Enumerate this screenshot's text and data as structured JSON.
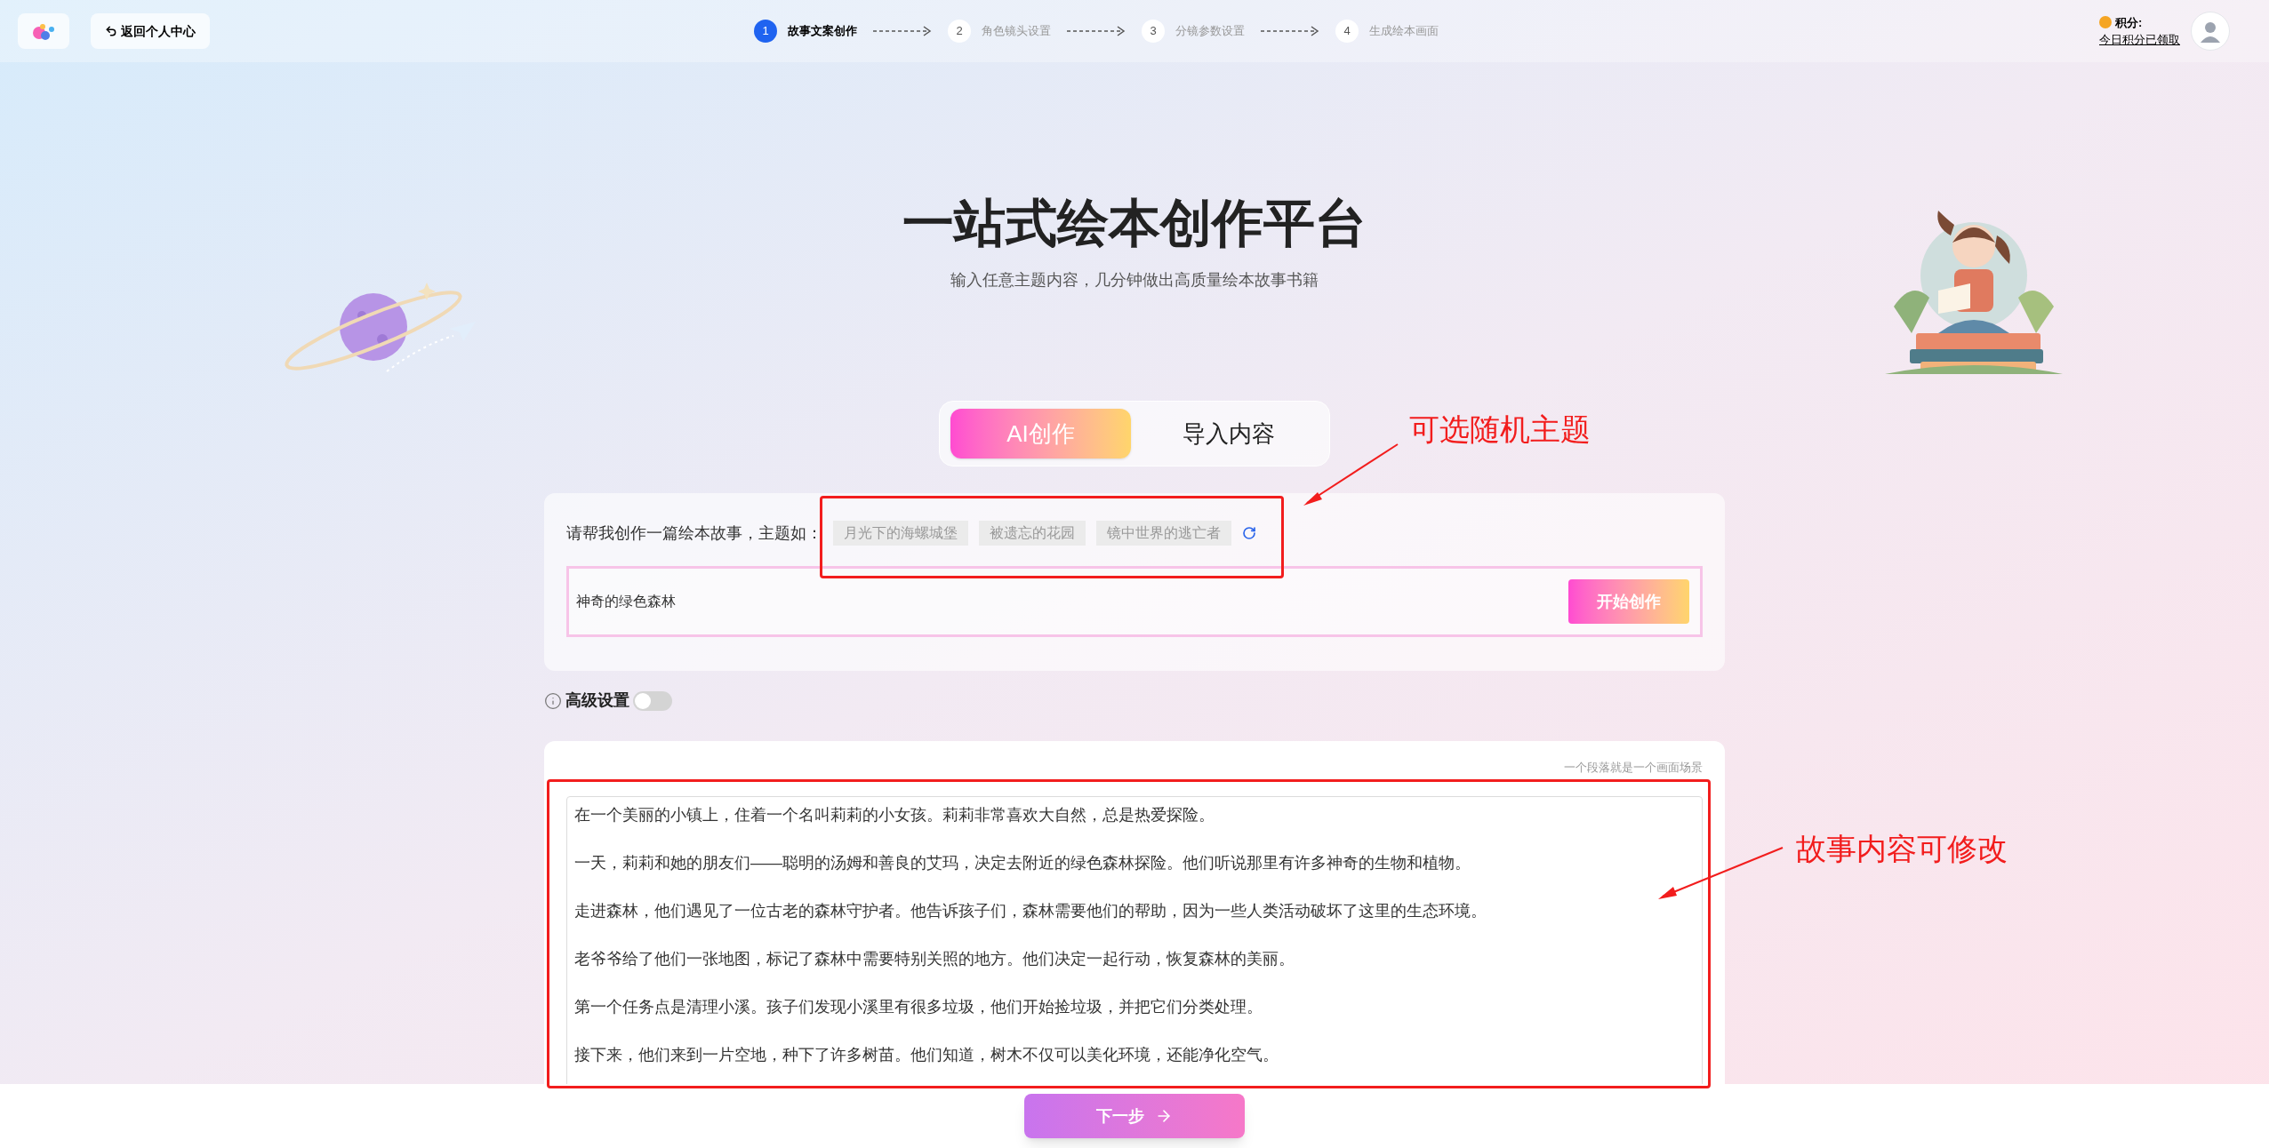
{
  "header": {
    "back_button": "返回个人中心",
    "points_label": "积分:",
    "points_link": "今日积分已领取"
  },
  "steps": [
    {
      "number": "1",
      "label": "故事文案创作",
      "selected": true
    },
    {
      "number": "2",
      "label": "角色镜头设置",
      "selected": false
    },
    {
      "number": "3",
      "label": "分镜参数设置",
      "selected": false
    },
    {
      "number": "4",
      "label": "生成绘本画面",
      "selected": false
    }
  ],
  "hero": {
    "title": "一站式绘本创作平台",
    "subtitle": "输入任意主题内容，几分钟做出高质量绘本故事书籍"
  },
  "mode_tabs": [
    {
      "label": "AI创作",
      "selected": true
    },
    {
      "label": "导入内容",
      "selected": false
    }
  ],
  "theme_card": {
    "prompt": "请帮我创作一篇绘本故事，主题如：",
    "suggestions": [
      "月光下的海螺城堡",
      "被遗忘的花园",
      "镜中世界的逃亡者"
    ],
    "input_value": "神奇的绿色森林",
    "start_button": "开始创作"
  },
  "advanced": {
    "label": "高级设置",
    "on": false
  },
  "story": {
    "hint": "一个段落就是一个画面场景",
    "paragraphs": [
      "在一个美丽的小镇上，住着一个名叫莉莉的小女孩。莉莉非常喜欢大自然，总是热爱探险。",
      "一天，莉莉和她的朋友们——聪明的汤姆和善良的艾玛，决定去附近的绿色森林探险。他们听说那里有许多神奇的生物和植物。",
      "走进森林，他们遇见了一位古老的森林守护者。他告诉孩子们，森林需要他们的帮助，因为一些人类活动破坏了这里的生态环境。",
      "老爷爷给了他们一张地图，标记了森林中需要特别关照的地方。他们决定一起行动，恢复森林的美丽。",
      "第一个任务点是清理小溪。孩子们发现小溪里有很多垃圾，他们开始捡垃圾，并把它们分类处理。",
      "接下来，他们来到一片空地，种下了许多树苗。他们知道，树木不仅可以美化环境，还能净化空气。"
    ]
  },
  "next_button": "下一步",
  "annotations": [
    {
      "text": "可选随机主题"
    },
    {
      "text": "故事内容可修改"
    }
  ]
}
